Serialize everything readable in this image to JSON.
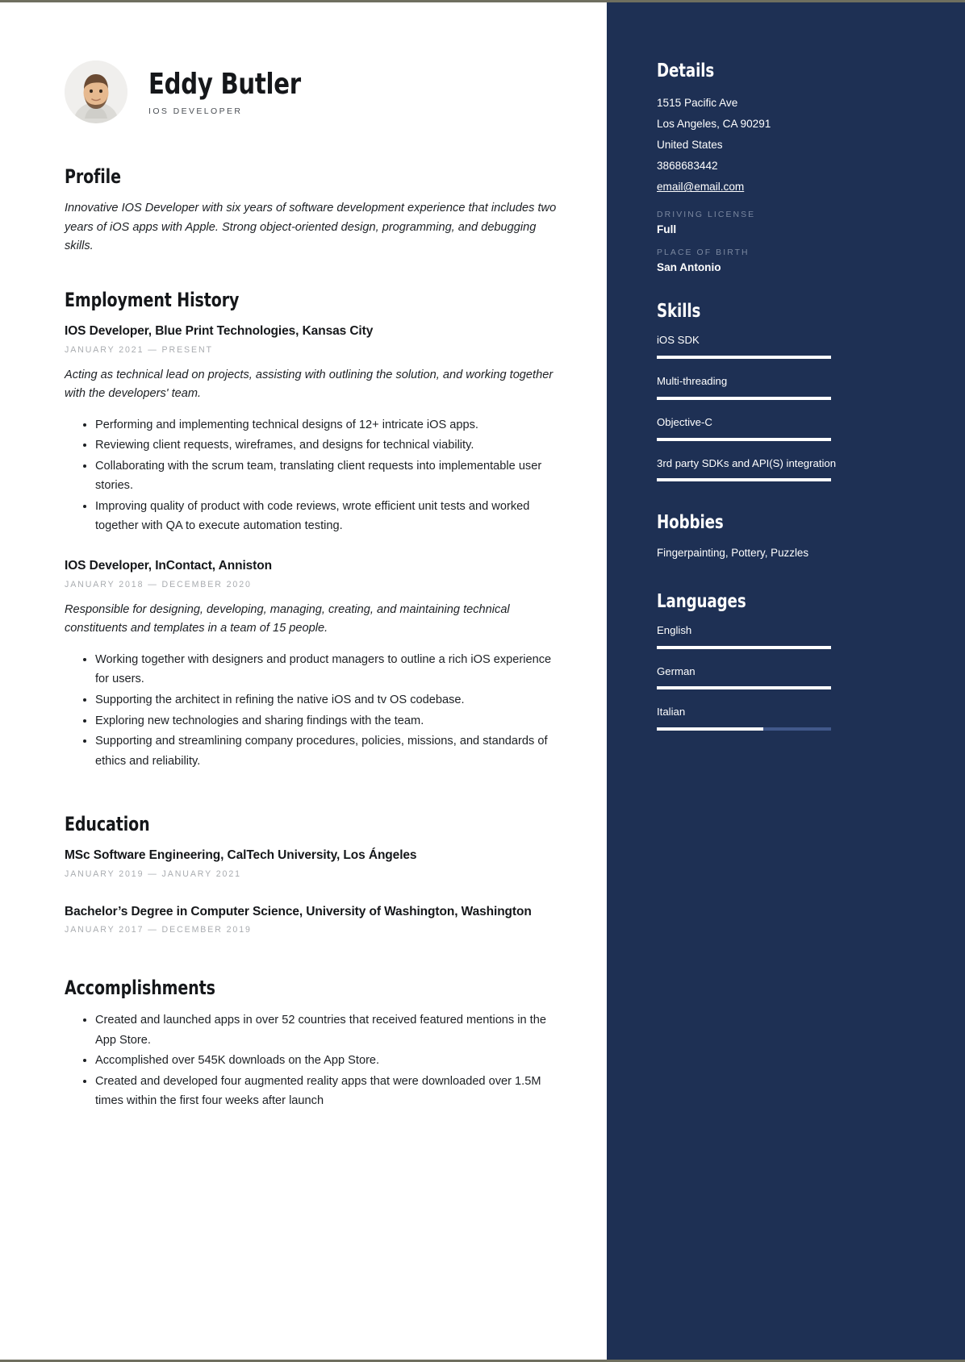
{
  "person": {
    "name": "Eddy Butler",
    "title": "IOS DEVELOPER",
    "avatar_icon": "user-photo"
  },
  "main": {
    "profile": {
      "heading": "Profile",
      "text": "Innovative IOS Developer with six years of software development experience that includes two years of iOS apps with Apple. Strong object-oriented design, programming, and debugging skills."
    },
    "employment": {
      "heading": "Employment History",
      "jobs": [
        {
          "title": "IOS Developer, Blue Print Technologies, Kansas City",
          "date": "JANUARY 2021 — PRESENT",
          "description": "Acting as technical lead on projects, assisting with outlining the solution, and working together with the developers' team.",
          "bullets": [
            "Performing and implementing technical designs of 12+ intricate iOS apps.",
            "Reviewing client requests, wireframes, and designs for technical viability.",
            "Collaborating with the scrum team, translating client requests into implementable user stories.",
            "Improving quality of product with code reviews, wrote efficient unit tests and worked together with QA to execute automation testing."
          ]
        },
        {
          "title": "IOS Developer, InContact, Anniston",
          "date": "JANUARY 2018 — DECEMBER 2020",
          "description": "Responsible for designing, developing, managing, creating, and maintaining technical constituents and templates in a team of 15 people.",
          "bullets": [
            "Working together with designers and product managers to outline a rich iOS experience for users.",
            "Supporting the architect in refining the native iOS and tv OS codebase.",
            "Exploring new technologies and sharing findings with the team.",
            "Supporting and streamlining company procedures, policies, missions, and standards of ethics and reliability."
          ]
        }
      ]
    },
    "education": {
      "heading": "Education",
      "entries": [
        {
          "title": "MSc Software Engineering,  CalTech University, Los Ángeles",
          "date": "JANUARY 2019 — JANUARY 2021"
        },
        {
          "title": "Bachelor’s Degree in Computer Science, University of Washington, Washington",
          "date": "JANUARY 2017 — DECEMBER 2019"
        }
      ]
    },
    "accomplishments": {
      "heading": "Accomplishments",
      "bullets": [
        "Created and launched apps in over 52 countries that received featured mentions in the App Store.",
        "Accomplished over 545K downloads on the App Store.",
        "Created and developed four augmented reality apps that were downloaded over 1.5M times within the first four weeks after launch"
      ]
    }
  },
  "sidebar": {
    "details": {
      "heading": "Details",
      "address_line1": "1515 Pacific Ave",
      "address_line2": "Los Angeles, CA 90291",
      "country": "United States",
      "phone": "3868683442",
      "email": "email@email.com",
      "driving_license_label": "DRIVING LICENSE",
      "driving_license_value": "Full",
      "place_of_birth_label": "PLACE OF BIRTH",
      "place_of_birth_value": "San Antonio"
    },
    "skills": {
      "heading": "Skills",
      "items": [
        {
          "label": "iOS SDK",
          "level": 100
        },
        {
          "label": "Multi-threading",
          "level": 100
        },
        {
          "label": "Objective-C",
          "level": 100
        },
        {
          "label": "3rd party SDKs and API(S) integration",
          "level": 100
        }
      ]
    },
    "hobbies": {
      "heading": "Hobbies",
      "text": "Fingerpainting, Pottery, Puzzles"
    },
    "languages": {
      "heading": "Languages",
      "items": [
        {
          "label": "English",
          "level": 100
        },
        {
          "label": "German",
          "level": 100
        },
        {
          "label": "Italian",
          "level": 61
        }
      ]
    }
  },
  "colors": {
    "sidebar_bg": "#1e3054",
    "bar_fill": "#ffffff",
    "bar_track": "#41588a",
    "muted_label": "#7b88a0",
    "date_gray": "#a9acb0"
  }
}
